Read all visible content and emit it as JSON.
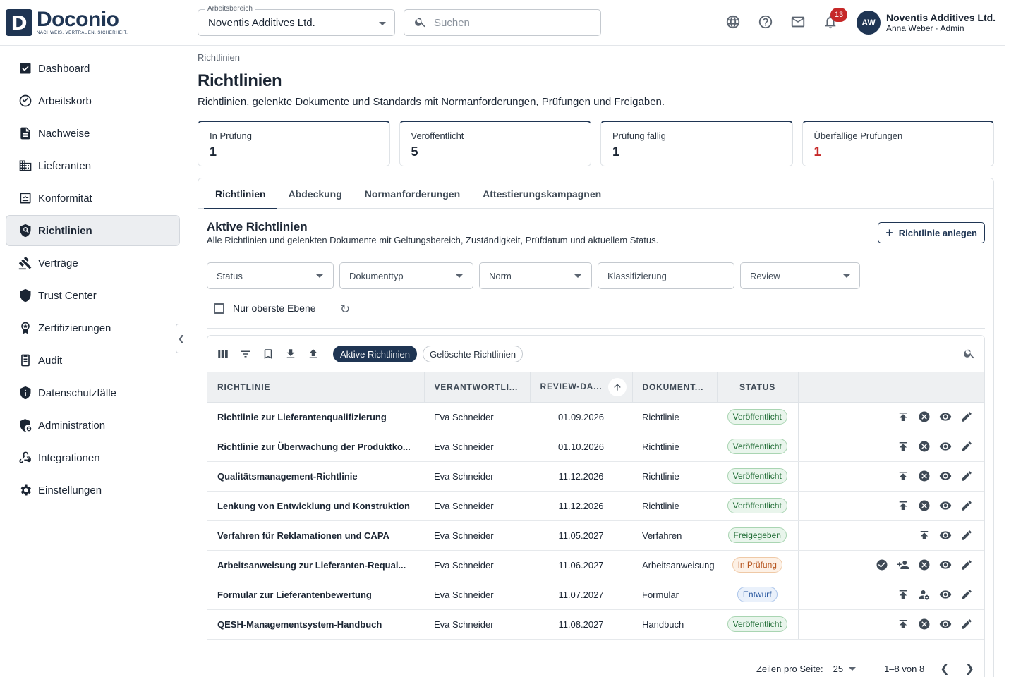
{
  "brand": {
    "letter": "D",
    "name": "Doconio",
    "tagline": "NACHWEIS. VERTRAUEN. SICHERHEIT."
  },
  "sidebar": {
    "items": [
      {
        "label": "Dashboard",
        "icon": "dashboard-icon"
      },
      {
        "label": "Arbeitskorb",
        "icon": "check-circle-icon"
      },
      {
        "label": "Nachweise",
        "icon": "document-icon"
      },
      {
        "label": "Lieferanten",
        "icon": "building-icon"
      },
      {
        "label": "Konformität",
        "icon": "checklist-icon"
      },
      {
        "label": "Richtlinien",
        "icon": "policy-shield-icon",
        "active": true
      },
      {
        "label": "Verträge",
        "icon": "gavel-icon"
      },
      {
        "label": "Trust Center",
        "icon": "shield-icon"
      },
      {
        "label": "Zertifizierungen",
        "icon": "award-icon"
      },
      {
        "label": "Audit",
        "icon": "audit-icon"
      },
      {
        "label": "Datenschutzfälle",
        "icon": "privacy-shield-icon"
      },
      {
        "label": "Administration",
        "icon": "admin-icon"
      },
      {
        "label": "Integrationen",
        "icon": "webhook-icon"
      },
      {
        "label": "Einstellungen",
        "icon": "gear-icon"
      }
    ]
  },
  "topbar": {
    "workspace_label": "Arbeitsbereich",
    "workspace_value": "Noventis Additives Ltd.",
    "search_placeholder": "Suchen",
    "notification_count": "13",
    "avatar_initials": "AW",
    "user_org": "Noventis Additives Ltd.",
    "user_name": "Anna Weber · Admin"
  },
  "page": {
    "breadcrumb": "Richtlinien",
    "title": "Richtlinien",
    "subtitle": "Richtlinien, gelenkte Dokumente und Standards mit Normanforderungen, Prüfungen und Freigaben."
  },
  "stats": [
    {
      "label": "In Prüfung",
      "value": "1"
    },
    {
      "label": "Veröffentlicht",
      "value": "5"
    },
    {
      "label": "Prüfung fällig",
      "value": "1"
    },
    {
      "label": "Überfällige Prüfungen",
      "value": "1",
      "danger": true
    }
  ],
  "tabs": [
    "Richtlinien",
    "Abdeckung",
    "Normanforderungen",
    "Attestierungskampagnen"
  ],
  "section": {
    "title": "Aktive Richtlinien",
    "subtitle": "Alle Richtlinien und gelenkten Dokumente mit Geltungsbereich, Zuständigkeit, Prüfdatum und aktuellem Status.",
    "add_button": "Richtlinie anlegen"
  },
  "filters": {
    "status": "Status",
    "doctype": "Dokumenttyp",
    "norm": "Norm",
    "classification": "Klassifizierung",
    "review": "Review",
    "top_level_only": "Nur oberste Ebene"
  },
  "grid": {
    "chips": [
      "Aktive Richtlinien",
      "Gelöschte Richtlinien"
    ],
    "columns": [
      "RICHTLINIE",
      "VERANTWORTLI...",
      "REVIEW-DA...",
      "DOKUMENT...",
      "STATUS"
    ],
    "rows": [
      {
        "title": "Richtlinie zur Lieferantenqualifizierung",
        "owner": "Eva Schneider",
        "review": "01.09.2026",
        "doctype": "Richtlinie",
        "status": "Veröffentlicht",
        "tone": "green",
        "actions": [
          "publish-icon",
          "cancel-icon",
          "view-icon",
          "edit-icon"
        ]
      },
      {
        "title": "Richtlinie zur Überwachung der Produktko...",
        "owner": "Eva Schneider",
        "review": "01.10.2026",
        "doctype": "Richtlinie",
        "status": "Veröffentlicht",
        "tone": "green",
        "actions": [
          "publish-icon",
          "cancel-icon",
          "view-icon",
          "edit-icon"
        ]
      },
      {
        "title": "Qualitätsmanagement-Richtlinie",
        "owner": "Eva Schneider",
        "review": "11.12.2026",
        "doctype": "Richtlinie",
        "status": "Veröffentlicht",
        "tone": "green",
        "actions": [
          "publish-icon",
          "cancel-icon",
          "view-icon",
          "edit-icon"
        ]
      },
      {
        "title": "Lenkung von Entwicklung und Konstruktion",
        "owner": "Eva Schneider",
        "review": "11.12.2026",
        "doctype": "Richtlinie",
        "status": "Veröffentlicht",
        "tone": "green",
        "actions": [
          "publish-icon",
          "cancel-icon",
          "view-icon",
          "edit-icon"
        ]
      },
      {
        "title": "Verfahren für Reklamationen und CAPA",
        "owner": "Eva Schneider",
        "review": "11.05.2027",
        "doctype": "Verfahren",
        "status": "Freigegeben",
        "tone": "green",
        "actions": [
          "publish-icon",
          "view-icon",
          "edit-icon"
        ]
      },
      {
        "title": "Arbeitsanweisung zur Lieferanten-Requal...",
        "owner": "Eva Schneider",
        "review": "11.06.2027",
        "doctype": "Arbeitsanweisung",
        "status": "In Prüfung",
        "tone": "orange",
        "actions": [
          "approve-icon",
          "assign-reviewer-icon",
          "cancel-icon",
          "view-icon",
          "edit-icon"
        ]
      },
      {
        "title": "Formular zur Lieferantenbewertung",
        "owner": "Eva Schneider",
        "review": "11.07.2027",
        "doctype": "Formular",
        "status": "Entwurf",
        "tone": "blue",
        "actions": [
          "publish-icon",
          "manage-access-icon",
          "view-icon",
          "edit-icon"
        ]
      },
      {
        "title": "QESH-Managementsystem-Handbuch",
        "owner": "Eva Schneider",
        "review": "11.08.2027",
        "doctype": "Handbuch",
        "status": "Veröffentlicht",
        "tone": "green",
        "actions": [
          "publish-icon",
          "cancel-icon",
          "view-icon",
          "edit-icon"
        ]
      }
    ],
    "rows_per_page_label": "Zeilen pro Seite:",
    "rows_per_page": "25",
    "range": "1–8 von 8"
  },
  "colors": {
    "brand": "#1f3553",
    "danger": "#c62828"
  }
}
